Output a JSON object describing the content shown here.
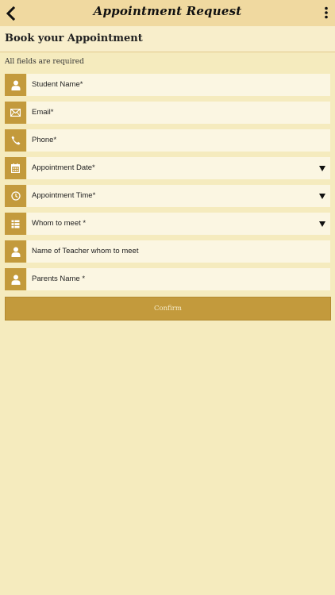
{
  "appbar": {
    "title": "Appointment Request",
    "back_icon": "chevron-left-icon",
    "menu_icon": "more-vertical-icon"
  },
  "section": {
    "title": "Book your Appointment"
  },
  "form": {
    "required_note": "All fields are required",
    "fields": [
      {
        "placeholder": "Student Name*",
        "icon": "user-icon",
        "type": "text"
      },
      {
        "placeholder": "Email*",
        "icon": "envelope-icon",
        "type": "text"
      },
      {
        "placeholder": "Phone*",
        "icon": "phone-icon",
        "type": "text"
      },
      {
        "placeholder": "Appointment Date*",
        "icon": "calendar-icon",
        "type": "dropdown"
      },
      {
        "placeholder": "Appointment Time*",
        "icon": "clock-icon",
        "type": "dropdown"
      },
      {
        "placeholder": "Whom to meet *",
        "icon": "list-icon",
        "type": "dropdown"
      },
      {
        "placeholder": "Name of Teacher whom to meet",
        "icon": "user-icon",
        "type": "text"
      },
      {
        "placeholder": "Parents Name *",
        "icon": "user-icon",
        "type": "text"
      }
    ],
    "confirm_label": "Confirm"
  },
  "colors": {
    "background": "#f5ebbe",
    "appbar": "#f0d9a0",
    "accent": "#c39a3c",
    "field": "#fbf6e2"
  }
}
